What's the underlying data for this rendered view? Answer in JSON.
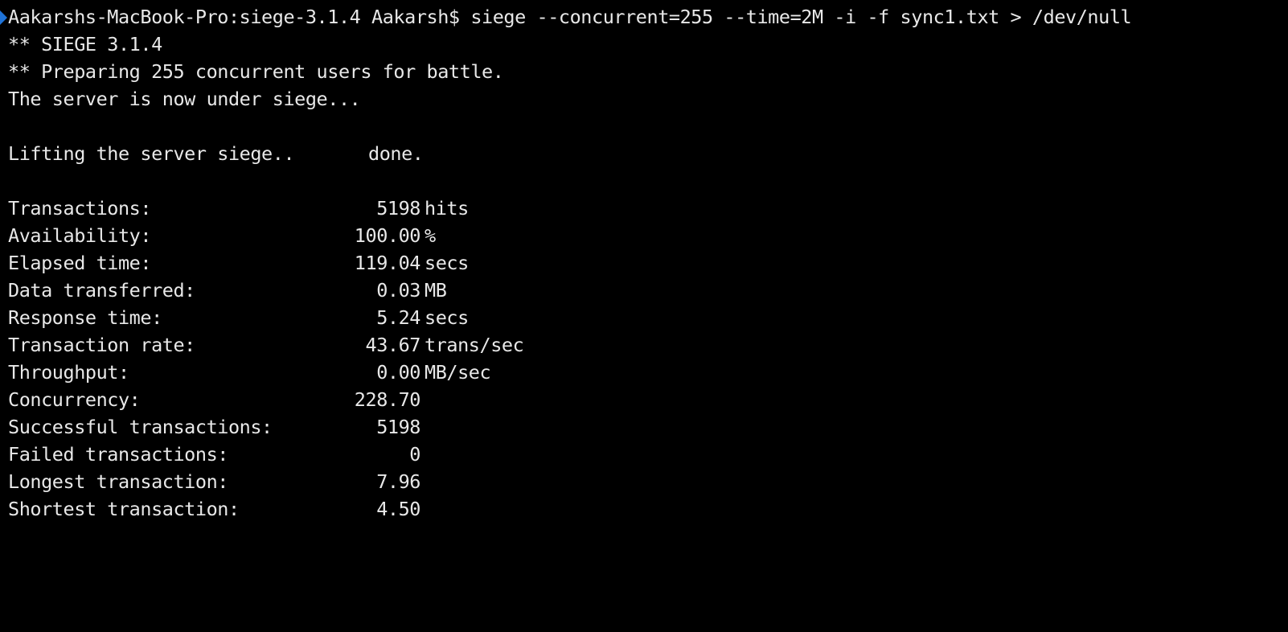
{
  "terminal": {
    "prompt": "Aakarshs-MacBook-Pro:siege-3.1.4 Aakarsh$ siege --concurrent=255 --time=2M -i -f sync1.txt > /dev/null",
    "output_lines": [
      "** SIEGE 3.1.4",
      "** Preparing 255 concurrent users for battle.",
      "The server is now under siege..."
    ],
    "lift": {
      "text": "Lifting the server siege..",
      "status": "done."
    },
    "stats": [
      {
        "label": "Transactions:",
        "value": "5198",
        "unit": "hits"
      },
      {
        "label": "Availability:",
        "value": "100.00",
        "unit": "%"
      },
      {
        "label": "Elapsed time:",
        "value": "119.04",
        "unit": "secs"
      },
      {
        "label": "Data transferred:",
        "value": "0.03",
        "unit": "MB"
      },
      {
        "label": "Response time:",
        "value": "5.24",
        "unit": "secs"
      },
      {
        "label": "Transaction rate:",
        "value": "43.67",
        "unit": "trans/sec"
      },
      {
        "label": "Throughput:",
        "value": "0.00",
        "unit": "MB/sec"
      },
      {
        "label": "Concurrency:",
        "value": "228.70",
        "unit": ""
      },
      {
        "label": "Successful transactions:",
        "value": "5198",
        "unit": ""
      },
      {
        "label": "Failed transactions:",
        "value": "0",
        "unit": ""
      },
      {
        "label": "Longest transaction:",
        "value": "7.96",
        "unit": ""
      },
      {
        "label": "Shortest transaction:",
        "value": "4.50",
        "unit": ""
      }
    ]
  },
  "colors": {
    "background": "#000000",
    "text": "#e8e8e8",
    "mark_indicator": "#1f73d8"
  }
}
